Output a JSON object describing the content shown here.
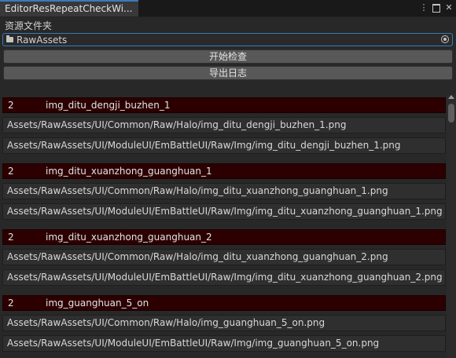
{
  "window": {
    "tab_title": "EditorResRepeatCheckWi...",
    "more_icon": "⋮",
    "close_icon": "✕"
  },
  "folder": {
    "label": "资源文件夹",
    "value": "RawAssets"
  },
  "buttons": {
    "check": "开始检查",
    "export": "导出日志"
  },
  "groups": [
    {
      "count": "2",
      "name": "img_ditu_dengji_buzhen_1",
      "paths": [
        "Assets/RawAssets/UI/Common/Raw/Halo/img_ditu_dengji_buzhen_1.png",
        "Assets/RawAssets/UI/ModuleUI/EmBattleUI/Raw/Img/img_ditu_dengji_buzhen_1.png"
      ]
    },
    {
      "count": "2",
      "name": "img_ditu_xuanzhong_guanghuan_1",
      "paths": [
        "Assets/RawAssets/UI/Common/Raw/Halo/img_ditu_xuanzhong_guanghuan_1.png",
        "Assets/RawAssets/UI/ModuleUI/EmBattleUI/Raw/Img/img_ditu_xuanzhong_guanghuan_1.png"
      ]
    },
    {
      "count": "2",
      "name": "img_ditu_xuanzhong_guanghuan_2",
      "paths": [
        "Assets/RawAssets/UI/Common/Raw/Halo/img_ditu_xuanzhong_guanghuan_2.png",
        "Assets/RawAssets/UI/ModuleUI/EmBattleUI/Raw/Img/img_ditu_xuanzhong_guanghuan_2.png"
      ]
    },
    {
      "count": "2",
      "name": "img_guanghuan_5_on",
      "paths": [
        "Assets/RawAssets/UI/Common/Raw/Halo/img_guanghuan_5_on.png",
        "Assets/RawAssets/UI/ModuleUI/EmBattleUI/Raw/Img/img_guanghuan_5_on.png"
      ]
    }
  ]
}
